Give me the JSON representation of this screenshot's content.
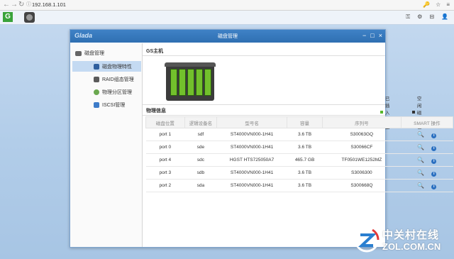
{
  "browser": {
    "back": "←",
    "forward": "→",
    "reload": "↻",
    "secure": "ⓘ",
    "url": "192.168.1.101",
    "right_icons": [
      "🔑",
      "☆",
      "≡"
    ]
  },
  "taskbar": {
    "logo": "G",
    "right_icons": [
      "⚿",
      "⚙",
      "⊟",
      "👤"
    ]
  },
  "window": {
    "brand": "Glada",
    "title": "磁盘管理",
    "controls": {
      "minimize": "−",
      "maximize": "□",
      "close": "×"
    }
  },
  "sidebar": {
    "header": "磁盘管理",
    "items": [
      {
        "label": "磁盘物理特性",
        "icon_color": "#2f5f9e",
        "active": true
      },
      {
        "label": "RAID组态管理",
        "icon_color": "#5a5a5a",
        "active": false
      },
      {
        "label": "物理分区管理",
        "icon_color": "#6aa84f",
        "active": false
      },
      {
        "label": "ISCSI管理",
        "icon_color": "#3d7cc9",
        "active": false
      }
    ]
  },
  "host": {
    "title": "GS主机",
    "legend_inserted": "已插入磁盘",
    "legend_empty": "空闲磁盘位",
    "colors": {
      "inserted": "#58b72c",
      "empty": "#333333"
    }
  },
  "physical": {
    "title": "物理信息",
    "columns": [
      "磁盘位置",
      "逻辑设备名",
      "型号名",
      "容量",
      "序列号",
      "SMART 操作"
    ],
    "rows": [
      {
        "pos": "port 1",
        "dev": "sdf",
        "model": "ST4000VN000-1H41",
        "cap": "3.6 TB",
        "serial": "S30063GQ"
      },
      {
        "pos": "port 0",
        "dev": "sde",
        "model": "ST4000VN000-1H41",
        "cap": "3.6 TB",
        "serial": "S30066CF"
      },
      {
        "pos": "port 4",
        "dev": "sdc",
        "model": "HGST HTS725050A7",
        "cap": "465.7 GB",
        "serial": "TF0501WE1252MZ"
      },
      {
        "pos": "port 3",
        "dev": "sdb",
        "model": "ST4000VN000-1H41",
        "cap": "3.6 TB",
        "serial": "S3006300"
      },
      {
        "pos": "port 2",
        "dev": "sda",
        "model": "ST4000VN000-1H41",
        "cap": "3.6 TB",
        "serial": "S300668Q"
      }
    ],
    "op_search": "🔍",
    "op_info": "i"
  },
  "watermark": {
    "cn": "中关村在线",
    "en": "ZOL.COM.CN"
  }
}
